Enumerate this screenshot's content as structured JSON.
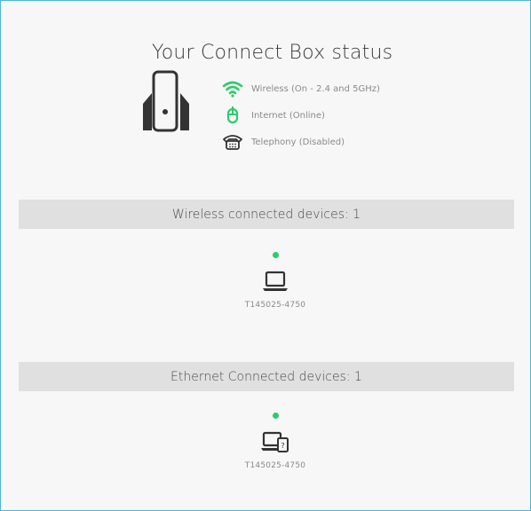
{
  "status": {
    "title": "Your Connect Box status",
    "items": [
      {
        "label": "Wireless (On - 2.4 and 5GHz)",
        "icon": "wifi-icon",
        "color": "#2ecb6b"
      },
      {
        "label": "Internet (Online)",
        "icon": "mouse-icon",
        "color": "#2ecb6b"
      },
      {
        "label": "Telephony (Disabled)",
        "icon": "telephone-icon",
        "color": "#333333"
      }
    ]
  },
  "wireless": {
    "header": "Wireless connected devices: 1",
    "devices": [
      {
        "name": "T145025-4750",
        "icon": "laptop-icon",
        "status_color": "#2ecb6b"
      }
    ]
  },
  "ethernet": {
    "header": "Ethernet Connected devices: 1",
    "devices": [
      {
        "name": "T145025-4750",
        "icon": "computer-unknown-device-icon",
        "status_color": "#2ecb6b"
      }
    ]
  },
  "colors": {
    "accent": "#2ecb6b",
    "border": "#4fb6d8",
    "section_bar": "#e0e0e0"
  }
}
